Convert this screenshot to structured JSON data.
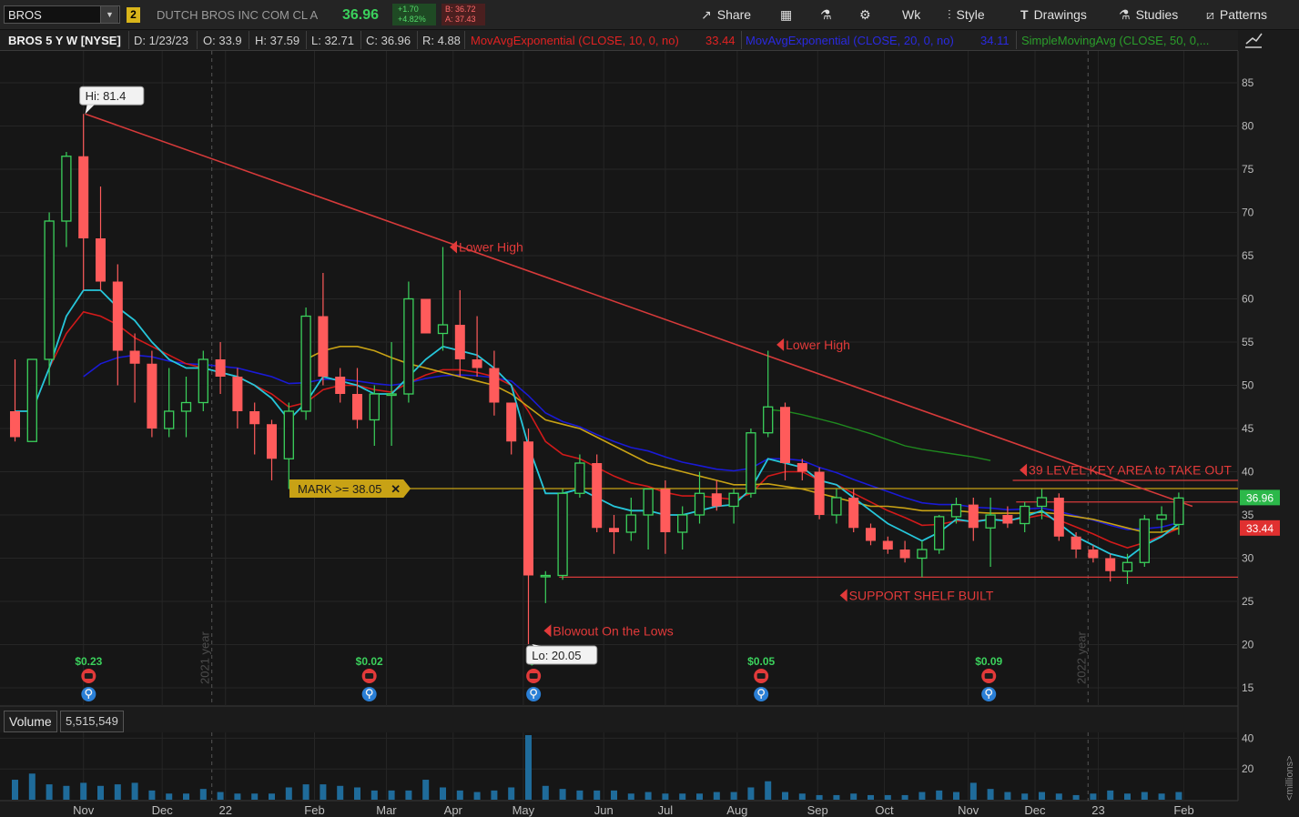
{
  "toolbar": {
    "symbol": "BROS",
    "link_number": "2",
    "company": "DUTCH BROS INC COM CL A",
    "last": "36.96",
    "change": "+1.70",
    "change_pct": "+4.82%",
    "bid": "B: 36.72",
    "ask": "A: 37.43",
    "share": "Share",
    "aggregation": "Wk",
    "style": "Style",
    "drawings": "Drawings",
    "studies": "Studies",
    "patterns": "Patterns"
  },
  "header": {
    "title": "BROS 5 Y W [NYSE]",
    "date": "D: 1/23/23",
    "open": "O: 33.9",
    "high": "H: 37.59",
    "low": "L: 32.71",
    "close": "C: 36.96",
    "range": "R: 4.88",
    "ema10": "MovAvgExponential (CLOSE, 10, 0, no)",
    "ema10_val": "33.44",
    "ema20": "MovAvgExponential (CLOSE, 20, 0, no)",
    "ema20_val": "34.11",
    "sma50": "SimpleMovingAvg (CLOSE, 50, 0,..."
  },
  "volume": {
    "label": "Volume",
    "value": "5,515,549"
  },
  "colors": {
    "up": "#3bd15c",
    "down": "#ff5b5b",
    "ema10": "#d11a1a",
    "ema20": "#1a1ad6",
    "sma50": "#1f8a1f",
    "ema_fast": "#26c6da",
    "ema_slow": "#c8a215",
    "price_badge": "#2cb84a",
    "ma_badge": "#e03030"
  },
  "chart_data": [
    {
      "type": "candlestick",
      "title": "BROS 5 Y W [NYSE]",
      "ylim": [
        13,
        88
      ],
      "y_ticks": [
        15,
        20,
        25,
        30,
        35,
        40,
        45,
        50,
        55,
        60,
        65,
        70,
        75,
        80,
        85
      ],
      "x_labels": [
        "Nov",
        "Dec",
        "22",
        "Feb",
        "Mar",
        "Apr",
        "May",
        "Jun",
        "Jul",
        "Aug",
        "Sep",
        "Oct",
        "Nov",
        "Dec",
        "23",
        "Feb"
      ],
      "x_label_index": [
        4,
        8.6,
        12.3,
        17.5,
        21.7,
        25.6,
        29.7,
        34.4,
        38,
        42.2,
        46.9,
        50.8,
        55.7,
        59.6,
        63.3,
        68.3
      ],
      "year_markers": [
        {
          "text": "2021 year",
          "index": 11.5
        },
        {
          "text": "2022 year",
          "index": 62.7
        }
      ],
      "candles": [
        [
          47,
          53,
          43.5,
          44
        ],
        [
          43.5,
          53,
          43.5,
          53
        ],
        [
          53,
          70,
          50,
          69
        ],
        [
          69,
          77,
          66,
          76.5
        ],
        [
          76.5,
          81.4,
          61,
          67
        ],
        [
          67,
          73,
          61,
          62
        ],
        [
          62,
          64,
          50,
          54
        ],
        [
          54,
          56,
          48,
          52.5
        ],
        [
          52.5,
          54,
          44,
          45
        ],
        [
          45,
          52,
          44,
          47
        ],
        [
          47,
          51,
          44,
          48
        ],
        [
          48,
          54,
          47,
          53
        ],
        [
          53,
          55,
          49,
          51
        ],
        [
          51,
          52,
          45,
          47
        ],
        [
          47,
          48,
          42,
          45.5
        ],
        [
          45.5,
          46,
          39,
          41.5
        ],
        [
          41.5,
          48,
          38,
          47
        ],
        [
          47,
          59,
          46,
          58
        ],
        [
          58,
          63,
          50,
          51
        ],
        [
          51,
          52,
          48,
          49
        ],
        [
          49,
          52,
          45,
          46
        ],
        [
          46,
          50,
          43,
          49
        ],
        [
          49,
          55,
          43,
          49
        ],
        [
          49,
          62,
          48,
          60
        ],
        [
          60,
          60,
          56,
          56
        ],
        [
          56,
          66,
          54,
          57
        ],
        [
          57,
          61,
          51,
          53
        ],
        [
          53,
          58,
          51,
          52
        ],
        [
          52,
          54,
          46.5,
          48
        ],
        [
          48,
          48,
          42,
          43.5
        ],
        [
          43.5,
          45,
          20.05,
          28
        ],
        [
          28,
          28.5,
          24.8,
          28
        ],
        [
          28,
          38,
          27.5,
          37.5
        ],
        [
          37.5,
          42,
          37,
          41
        ],
        [
          41,
          42,
          33,
          33.5
        ],
        [
          33.5,
          35,
          30.5,
          33
        ],
        [
          33,
          37,
          32,
          35
        ],
        [
          35,
          38,
          31,
          38
        ],
        [
          38,
          39,
          30.5,
          33
        ],
        [
          33,
          36,
          31,
          35
        ],
        [
          35,
          40,
          34,
          37.5
        ],
        [
          37.5,
          39,
          35.5,
          36
        ],
        [
          36,
          38,
          34,
          37.5
        ],
        [
          37.5,
          45,
          37,
          44.5
        ],
        [
          44.5,
          54,
          44,
          47.5
        ],
        [
          47.5,
          48,
          39,
          41
        ],
        [
          41,
          41.5,
          39,
          40
        ],
        [
          40,
          40.5,
          34.5,
          35
        ],
        [
          35,
          38,
          34,
          37
        ],
        [
          37,
          38,
          33,
          33.5
        ],
        [
          33.5,
          34,
          31.5,
          32
        ],
        [
          32,
          32.5,
          30.5,
          31
        ],
        [
          31,
          32,
          29.5,
          30
        ],
        [
          30,
          32,
          27.8,
          31
        ],
        [
          31,
          35,
          30.5,
          34.8
        ],
        [
          34.8,
          37,
          34,
          36.2
        ],
        [
          36.2,
          37,
          32,
          33.5
        ],
        [
          33.5,
          37,
          29,
          35
        ],
        [
          35,
          36,
          33.5,
          34
        ],
        [
          34,
          36.5,
          33,
          36
        ],
        [
          36,
          38,
          34.5,
          37
        ],
        [
          37,
          37.5,
          32,
          32.5
        ],
        [
          32.5,
          33,
          30,
          31
        ],
        [
          31,
          31.5,
          29.5,
          30
        ],
        [
          30,
          30.5,
          27.3,
          28.5
        ],
        [
          28.5,
          30.5,
          27,
          29.5
        ],
        [
          29.5,
          35,
          29,
          34.5
        ],
        [
          34.5,
          36,
          33,
          35
        ],
        [
          33.9,
          37.59,
          32.71,
          36.96
        ]
      ],
      "ema_fast": [
        47,
        47,
        52,
        58,
        61,
        61,
        59,
        57.5,
        55,
        53,
        52,
        52,
        51.5,
        51,
        50,
        48.5,
        46,
        48,
        51,
        50.5,
        50,
        49,
        49,
        51,
        53,
        54.5,
        54,
        53.5,
        52,
        50,
        43,
        37.5,
        37.5,
        38,
        37,
        36,
        35.5,
        35.5,
        35,
        35,
        35.5,
        36,
        36.2,
        38,
        41.5,
        41,
        40.5,
        39,
        38.5,
        37,
        35.5,
        34,
        33,
        32,
        33,
        34.5,
        34.2,
        34.5,
        34.3,
        34.8,
        35.5,
        34,
        32.5,
        31.5,
        30.5,
        30,
        31.5,
        32.5,
        34
      ],
      "ema_slow": [
        null,
        null,
        null,
        null,
        null,
        null,
        null,
        null,
        null,
        null,
        null,
        null,
        null,
        null,
        null,
        null,
        null,
        53,
        54,
        54.5,
        54.5,
        54,
        53.2,
        52.5,
        52,
        51.5,
        51,
        50.5,
        50,
        49,
        47.5,
        46,
        45.5,
        45,
        44,
        43,
        42,
        41,
        40.5,
        40,
        39.5,
        39,
        38.5,
        38.5,
        38.6,
        38.3,
        38,
        37.5,
        37,
        36.5,
        36,
        36,
        35.8,
        35.5,
        35.5,
        35.5,
        35.3,
        35.2,
        35.2,
        35.2,
        35.3,
        35.1,
        34.8,
        34.5,
        34,
        33.5,
        33,
        33,
        33.5
      ],
      "ema10": [
        null,
        null,
        52,
        56,
        58.5,
        58,
        57,
        55.5,
        54.5,
        53.5,
        52.5,
        52,
        51.5,
        51,
        50,
        49,
        47.5,
        48,
        49.5,
        50,
        50,
        49.5,
        49.2,
        50.3,
        51.2,
        51.8,
        51.8,
        51.5,
        51,
        50,
        47,
        43.5,
        42,
        41.5,
        40.5,
        39.5,
        38.7,
        38.3,
        37.6,
        37.2,
        37.2,
        37,
        36.8,
        37.5,
        39.5,
        40,
        40,
        39,
        38.5,
        37.5,
        36.5,
        35.5,
        34.7,
        33.8,
        33.9,
        34.3,
        34.3,
        34.5,
        34.4,
        34.6,
        35,
        34.4,
        33.6,
        32.8,
        31.9,
        31.2,
        31.8,
        32.6,
        33.44
      ],
      "ema20": [
        null,
        null,
        null,
        null,
        51,
        52.5,
        53.2,
        53.5,
        53.3,
        52.8,
        52.5,
        52.4,
        52.2,
        52,
        51.5,
        51,
        50.2,
        50.3,
        50.7,
        50.7,
        50.5,
        50.2,
        50,
        50.3,
        50.8,
        51.1,
        51.2,
        51.1,
        50.9,
        50.5,
        48.8,
        46.8,
        45.8,
        45.2,
        44.3,
        43.5,
        42.8,
        42.4,
        41.7,
        41.1,
        40.7,
        40.3,
        40.1,
        40.4,
        41.5,
        41.5,
        41.3,
        40.5,
        39.9,
        39.1,
        38.4,
        37.7,
        37,
        36.4,
        36.2,
        36.2,
        35.9,
        35.8,
        35.6,
        35.7,
        35.8,
        35.4,
        34.9,
        34.4,
        33.8,
        33.3,
        33.4,
        33.6,
        34.11
      ],
      "sma50": [
        null,
        null,
        null,
        null,
        null,
        null,
        null,
        null,
        null,
        null,
        null,
        null,
        null,
        null,
        null,
        null,
        null,
        null,
        null,
        null,
        null,
        null,
        null,
        null,
        null,
        null,
        null,
        null,
        null,
        null,
        null,
        null,
        null,
        null,
        null,
        null,
        null,
        null,
        null,
        null,
        null,
        null,
        null,
        null,
        47.2,
        47,
        46.6,
        46.1,
        45.6,
        45,
        44.4,
        43.7,
        43,
        42.6,
        42.3,
        42,
        41.7,
        41.3
      ],
      "trendline": {
        "from": [
          4.1,
          81.4
        ],
        "to": [
          68.8,
          36
        ]
      },
      "hlines": [
        {
          "level": 38.05,
          "color": "#c8a215",
          "from": 23,
          "label": "MARK >= 38.05"
        },
        {
          "level": 39,
          "color": "#d63a3a",
          "from": 58.3,
          "label": "39 LEVEL KEY AREA to TAKE OUT"
        },
        {
          "level": 36.5,
          "color": "#d63a3a",
          "from": 58.5
        },
        {
          "level": 27.8,
          "color": "#d63a3a",
          "from": 31.8,
          "label": "SUPPORT SHELF BUILT"
        }
      ],
      "annotations": [
        {
          "text": "Hi: 81.4",
          "type": "bubble",
          "at": [
            4.1,
            81.4
          ]
        },
        {
          "text": "Lo: 20.05",
          "type": "bubble",
          "at": [
            30.2,
            20.05
          ]
        },
        {
          "text": "Lower High",
          "type": "arrow",
          "at": [
            25.4,
            66
          ]
        },
        {
          "text": "Lower High",
          "type": "arrow",
          "at": [
            44.5,
            54.7
          ]
        },
        {
          "text": "Blowout On the Lows",
          "type": "arrow",
          "at": [
            30.9,
            21.6
          ]
        },
        {
          "text": "SUPPORT SHELF BUILT",
          "type": "arrow",
          "at": [
            48.2,
            25.7
          ]
        },
        {
          "text": "39 LEVEL KEY AREA to TAKE OUT",
          "type": "arrow",
          "at": [
            58.7,
            40.2
          ]
        }
      ],
      "dividends": [
        {
          "text": "$0.23",
          "index": 4.3
        },
        {
          "text": "$0.02",
          "index": 20.7
        },
        {
          "text": "$-",
          "index": 30.3
        },
        {
          "text": "$0.05",
          "index": 43.6
        },
        {
          "text": "$0.09",
          "index": 56.9
        }
      ],
      "price_badges": [
        {
          "text": "36.96",
          "value": 36.96,
          "kind": "price"
        },
        {
          "text": "33.44",
          "value": 33.44,
          "kind": "ma"
        }
      ]
    },
    {
      "type": "bar",
      "title": "Volume",
      "ylim": [
        0,
        42
      ],
      "y_ticks": [
        20,
        40
      ],
      "y_unit": "<millions>",
      "values": [
        13,
        17,
        10,
        9,
        11,
        9,
        10,
        11,
        6,
        4,
        4,
        7,
        5,
        4,
        4,
        4,
        8,
        10,
        10,
        9,
        8,
        6,
        6,
        6,
        13,
        8,
        6,
        5,
        6,
        8,
        42,
        9,
        7,
        6,
        6,
        6,
        4,
        5,
        4,
        4,
        4,
        5,
        5,
        8,
        12,
        5,
        4,
        3,
        3,
        4,
        3,
        3,
        3,
        5,
        6,
        5,
        11,
        7,
        5,
        4,
        5,
        4,
        3,
        4,
        6,
        4,
        5,
        4,
        5
      ]
    }
  ]
}
